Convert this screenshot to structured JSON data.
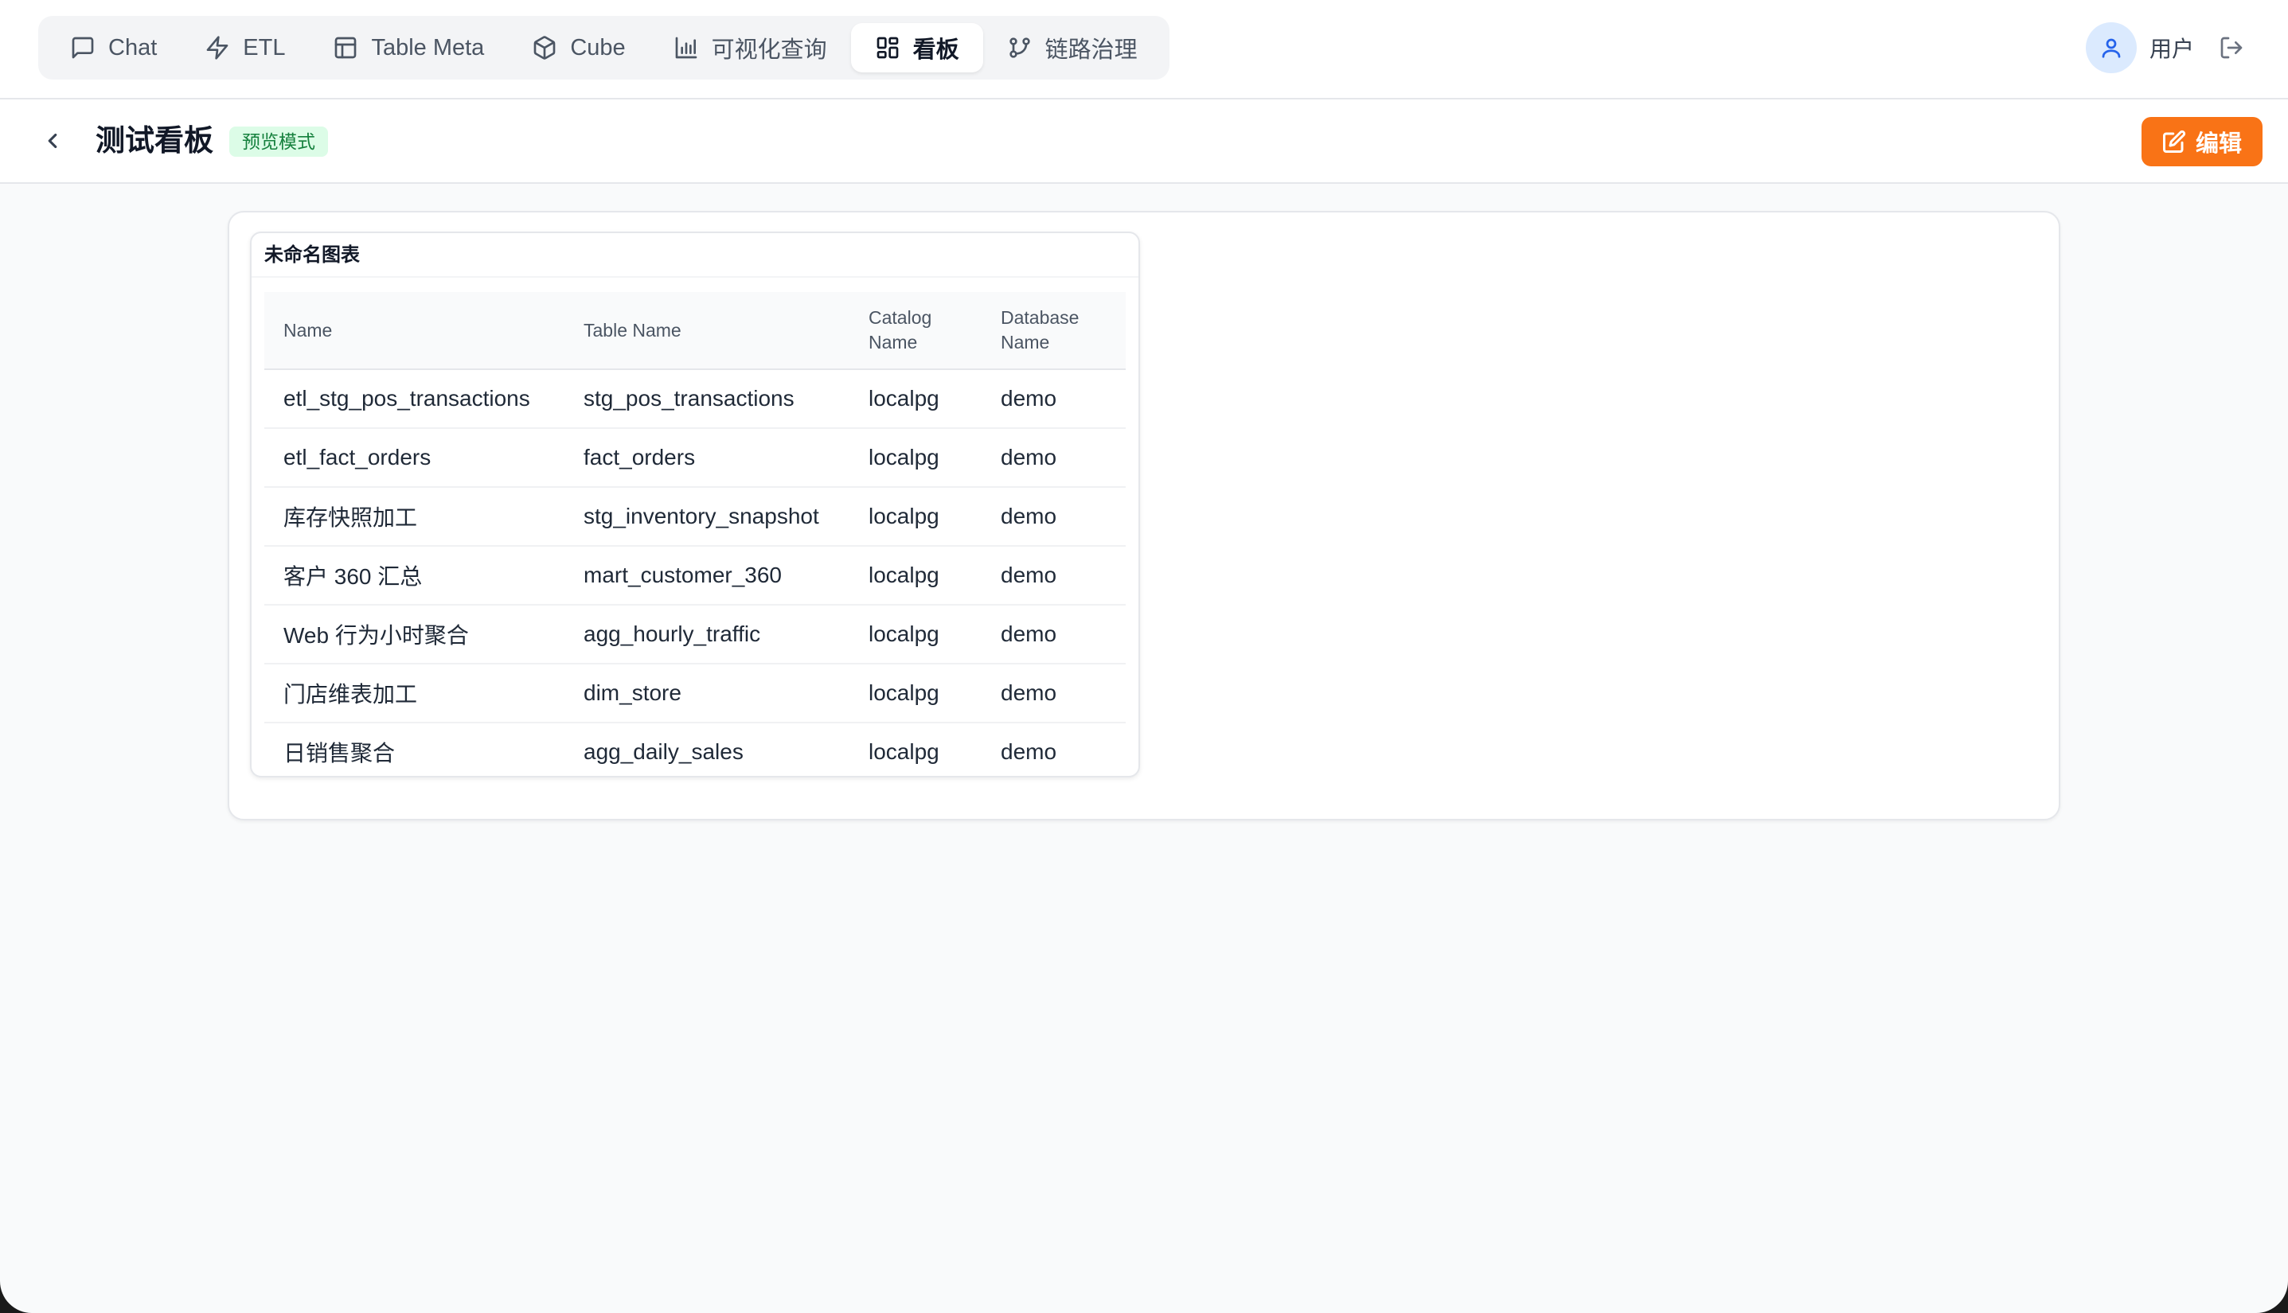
{
  "nav": {
    "tabs": [
      {
        "label": "Chat",
        "icon": "message-square-icon",
        "active": false
      },
      {
        "label": "ETL",
        "icon": "zap-icon",
        "active": false
      },
      {
        "label": "Table Meta",
        "icon": "table-icon",
        "active": false
      },
      {
        "label": "Cube",
        "icon": "cube-icon",
        "active": false
      },
      {
        "label": "可视化查询",
        "icon": "bar-chart-icon",
        "active": false
      },
      {
        "label": "看板",
        "icon": "dashboard-icon",
        "active": true
      },
      {
        "label": "链路治理",
        "icon": "git-branch-icon",
        "active": false
      }
    ]
  },
  "user": {
    "name": "用户",
    "avatar_icon": "user-icon",
    "logout_icon": "log-out-icon"
  },
  "header": {
    "title": "测试看板",
    "mode_badge": "预览模式",
    "edit_label": "编辑"
  },
  "widget": {
    "title": "未命名图表",
    "columns": [
      "Name",
      "Table Name",
      "Catalog Name",
      "Database Name"
    ],
    "rows": [
      [
        "etl_stg_pos_transactions",
        "stg_pos_transactions",
        "localpg",
        "demo"
      ],
      [
        "etl_fact_orders",
        "fact_orders",
        "localpg",
        "demo"
      ],
      [
        "库存快照加工",
        "stg_inventory_snapshot",
        "localpg",
        "demo"
      ],
      [
        "客户 360 汇总",
        "mart_customer_360",
        "localpg",
        "demo"
      ],
      [
        "Web 行为小时聚合",
        "agg_hourly_traffic",
        "localpg",
        "demo"
      ],
      [
        "门店维表加工",
        "dim_store",
        "localpg",
        "demo"
      ],
      [
        "日销售聚合",
        "agg_daily_sales",
        "localpg",
        "demo"
      ]
    ]
  },
  "colors": {
    "accent": "#f97316",
    "badge_bg": "#dcfce7",
    "badge_text": "#15803d",
    "avatar_bg": "#dbeafe"
  }
}
